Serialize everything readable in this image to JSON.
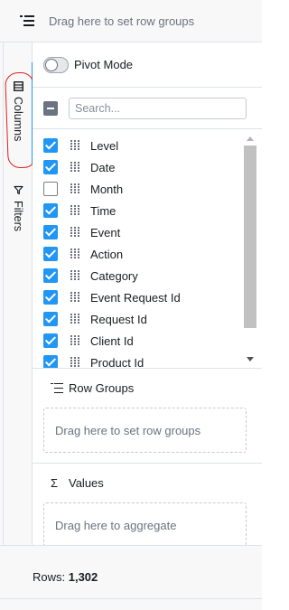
{
  "top_bar": {
    "placeholder_text": "Drag here to set row groups",
    "icon": "row-group-icon"
  },
  "side_tabs": [
    {
      "label": "Columns",
      "icon": "columns-icon"
    },
    {
      "label": "Filters",
      "icon": "filter-icon"
    }
  ],
  "pivot": {
    "label": "Pivot Mode",
    "enabled": false
  },
  "search": {
    "placeholder": "Search...",
    "value": ""
  },
  "columns": [
    {
      "label": "Level",
      "checked": true
    },
    {
      "label": "Date",
      "checked": true
    },
    {
      "label": "Month",
      "checked": false
    },
    {
      "label": "Time",
      "checked": true
    },
    {
      "label": "Event",
      "checked": true
    },
    {
      "label": "Action",
      "checked": true
    },
    {
      "label": "Category",
      "checked": true
    },
    {
      "label": "Event Request Id",
      "checked": true
    },
    {
      "label": "Request Id",
      "checked": true
    },
    {
      "label": "Client Id",
      "checked": true
    },
    {
      "label": "Product Id",
      "checked": true
    }
  ],
  "row_groups": {
    "label": "Row Groups",
    "icon": "row-group-icon",
    "drop_text": "Drag here to set row groups"
  },
  "values": {
    "label": "Values",
    "icon": "sigma-icon",
    "icon_glyph": "Σ",
    "drop_text": "Drag here to aggregate"
  },
  "status": {
    "label": "Rows: ",
    "value": "1,302"
  },
  "colors": {
    "accent": "#2196f3",
    "annotation": "#e01e1e",
    "border": "#dde2eb"
  }
}
